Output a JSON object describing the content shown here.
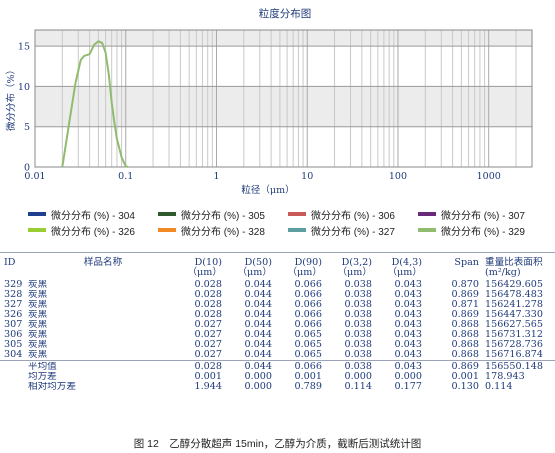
{
  "chart_data": {
    "type": "line",
    "title": "粒度分布图",
    "xlabel": "粒径（μm）",
    "ylabel": "微分分布（%）",
    "xscale": "log",
    "xlim": [
      0.01,
      3000
    ],
    "ylim": [
      0,
      17
    ],
    "xticks": [
      "0.01",
      "0.1",
      "1",
      "10",
      "100",
      "1000"
    ],
    "yticks": [
      "0",
      "5",
      "10",
      "15"
    ],
    "series": [
      {
        "name": "微分分布 (%) - 329",
        "x": [
          0.02,
          0.022,
          0.025,
          0.028,
          0.032,
          0.035,
          0.04,
          0.045,
          0.05,
          0.055,
          0.06,
          0.065,
          0.07,
          0.075,
          0.08,
          0.09,
          0.1,
          0.105
        ],
        "y": [
          0,
          3.0,
          7.0,
          10.5,
          13.3,
          13.8,
          14.0,
          15.2,
          15.6,
          15.4,
          14.2,
          11.5,
          8.0,
          5.5,
          3.5,
          1.2,
          0.1,
          0
        ]
      }
    ]
  },
  "legend": [
    {
      "label": "微分分布 (%) - 304",
      "color": "#1f3f8f"
    },
    {
      "label": "微分分布 (%) - 305",
      "color": "#2e5a2e"
    },
    {
      "label": "微分分布 (%) - 306",
      "color": "#c85a5a"
    },
    {
      "label": "微分分布 (%) - 307",
      "color": "#6a2a7a"
    },
    {
      "label": "微分分布 (%) - 326",
      "color": "#9acd32"
    },
    {
      "label": "微分分布 (%) - 328",
      "color": "#f08a24"
    },
    {
      "label": "微分分布 (%) - 327",
      "color": "#5f9ea0"
    },
    {
      "label": "微分分布 (%) - 329",
      "color": "#8fbc6f"
    }
  ],
  "table": {
    "headers": {
      "id": "ID",
      "name": "样品名称",
      "cols": [
        [
          "D(10)",
          "（μm）"
        ],
        [
          "D(50)",
          "（μm）"
        ],
        [
          "D(90)",
          "（μm）"
        ],
        [
          "D(3,2)",
          "（μm）"
        ],
        [
          "D(4,3)",
          "（μm）"
        ],
        [
          "Span",
          ""
        ],
        [
          "重量比表面积",
          "(m²/kg)"
        ]
      ]
    },
    "rows": [
      {
        "id": "329",
        "name": "炭黑",
        "v": [
          "0.028",
          "0.044",
          "0.066",
          "0.038",
          "0.043",
          "0.870",
          "156429.605"
        ]
      },
      {
        "id": "328",
        "name": "炭黑",
        "v": [
          "0.028",
          "0.044",
          "0.066",
          "0.038",
          "0.043",
          "0.869",
          "156478.483"
        ]
      },
      {
        "id": "327",
        "name": "炭黑",
        "v": [
          "0.028",
          "0.044",
          "0.066",
          "0.038",
          "0.043",
          "0.871",
          "156241.278"
        ]
      },
      {
        "id": "326",
        "name": "炭黑",
        "v": [
          "0.028",
          "0.044",
          "0.066",
          "0.038",
          "0.043",
          "0.869",
          "156447.330"
        ]
      },
      {
        "id": "307",
        "name": "炭黑",
        "v": [
          "0.027",
          "0.044",
          "0.066",
          "0.038",
          "0.043",
          "0.868",
          "156627.565"
        ]
      },
      {
        "id": "306",
        "name": "炭黑",
        "v": [
          "0.027",
          "0.044",
          "0.065",
          "0.038",
          "0.043",
          "0.868",
          "156731.312"
        ]
      },
      {
        "id": "305",
        "name": "炭黑",
        "v": [
          "0.027",
          "0.044",
          "0.065",
          "0.038",
          "0.043",
          "0.868",
          "156728.736"
        ]
      },
      {
        "id": "304",
        "name": "炭黑",
        "v": [
          "0.027",
          "0.044",
          "0.065",
          "0.038",
          "0.043",
          "0.868",
          "156716.874"
        ]
      }
    ],
    "stats": [
      {
        "name": "平均值",
        "v": [
          "0.028",
          "0.044",
          "0.066",
          "0.038",
          "0.043",
          "0.869",
          "156550.148"
        ]
      },
      {
        "name": "均方差",
        "v": [
          "0.001",
          "0.000",
          "0.001",
          "0.000",
          "0.000",
          "0.001",
          "178.943"
        ]
      },
      {
        "name": "相对均方差",
        "v": [
          "1.944",
          "0.000",
          "0.789",
          "0.114",
          "0.177",
          "0.130",
          "0.114"
        ]
      }
    ]
  },
  "caption": "图 12　乙醇分散超声 15min，乙醇为介质，截断后测试统计图"
}
